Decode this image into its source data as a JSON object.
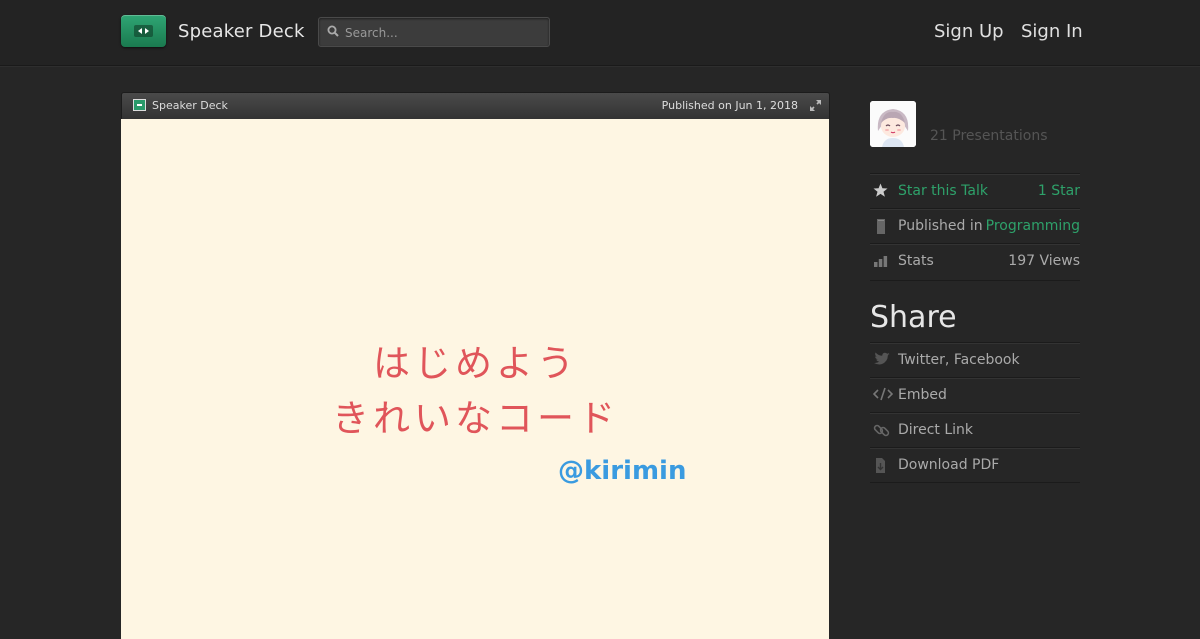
{
  "header": {
    "brand": "Speaker Deck",
    "search_placeholder": "Search...",
    "sign_up": "Sign Up",
    "sign_in": "Sign In"
  },
  "viewer": {
    "brand": "Speaker Deck",
    "published": "Published on Jun 1, 2018",
    "slide": {
      "title_line1": "はじめよう",
      "title_line2": "きれいなコード",
      "handle": "@kirimin"
    }
  },
  "sidebar": {
    "presentations": "21 Presentations",
    "star": {
      "label": "Star this Talk",
      "value": "1 Star"
    },
    "published_in": {
      "label": "Published in",
      "value": "Programming"
    },
    "stats": {
      "label": "Stats",
      "value": "197 Views"
    },
    "share_heading": "Share",
    "share_items": [
      {
        "label": "Twitter, Facebook",
        "icon": "twitter-icon"
      },
      {
        "label": "Embed",
        "icon": "code-icon"
      },
      {
        "label": "Direct Link",
        "icon": "link-icon"
      },
      {
        "label": "Download PDF",
        "icon": "pdf-icon"
      }
    ]
  },
  "colors": {
    "accent": "#2ea16a",
    "slide_bg": "#fef6e3",
    "slide_title": "#e0555a",
    "slide_handle": "#3a9be0"
  }
}
